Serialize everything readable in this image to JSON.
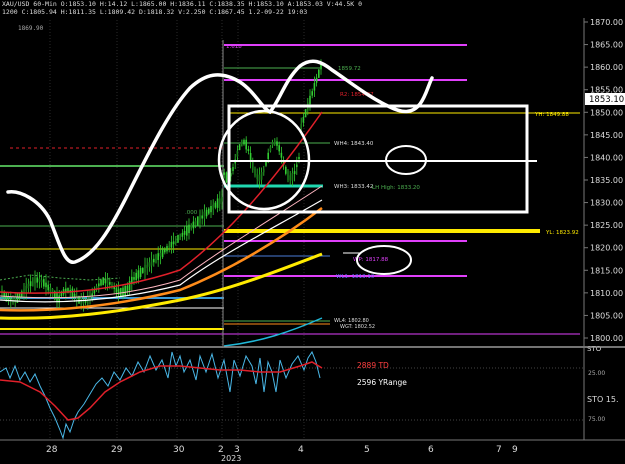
{
  "header": {
    "line1": "XAU/USD 60-Min  O:1853.10  H:14.12  L:1865.00  H:1836.11  C:1838.35  H:1853.10  A:1853.03  V:44.5K  0",
    "line2": "1200  C:1805.94  H:1811.35  L:1809.42  D:1818.32  V:2.250  C:1867.45  1.2-09-22  19:03",
    "corner_price": "1869.90"
  },
  "price_axis": {
    "ticks": [
      "1870.00",
      "1865.00",
      "1860.00",
      "1855.00",
      "1850.00",
      "1845.00",
      "1840.00",
      "1835.00",
      "1830.00",
      "1825.00",
      "1820.00",
      "1815.00",
      "1810.00",
      "1805.00",
      "1800.00"
    ],
    "last_price": "1853.10",
    "edge_label": "STO"
  },
  "levels": {
    "l_1818": "1.618",
    "l_1859": "1859.72",
    "r_1854": "R2: 1854.07",
    "yh": "YH: 1849.88",
    "wh4": "WH4: 1843.40",
    "wh3": "WH3: 1833.42",
    "lh_high": "LH High: 1833.20",
    "yl": "YL: 1823.92",
    "wp": "WP: 1817.88",
    "wl1": "WL1: 1813.10",
    "wl4": "WL4: 1802.80",
    "wgt": "WGT: 1802.52",
    "dot": ".000"
  },
  "oscillator": {
    "td_label": "2889 TD",
    "yrange_label": "2596 YRange",
    "sto_label": "STO 15.",
    "ticks": [
      "25.00",
      "75.00"
    ]
  },
  "time_axis": {
    "labels": [
      "28",
      "29",
      "30",
      "2",
      "3",
      "4",
      "5",
      "6",
      "7",
      "9"
    ],
    "year": "2023"
  },
  "colors": {
    "background": "#000000",
    "candle": "#32cd32",
    "magenta": "#e040fb",
    "yellow": "#ffeb00",
    "orange": "#ff8c1a",
    "white": "#ffffff",
    "red": "#e0202a",
    "cyan": "#20b8d8",
    "green": "#4caf50"
  }
}
